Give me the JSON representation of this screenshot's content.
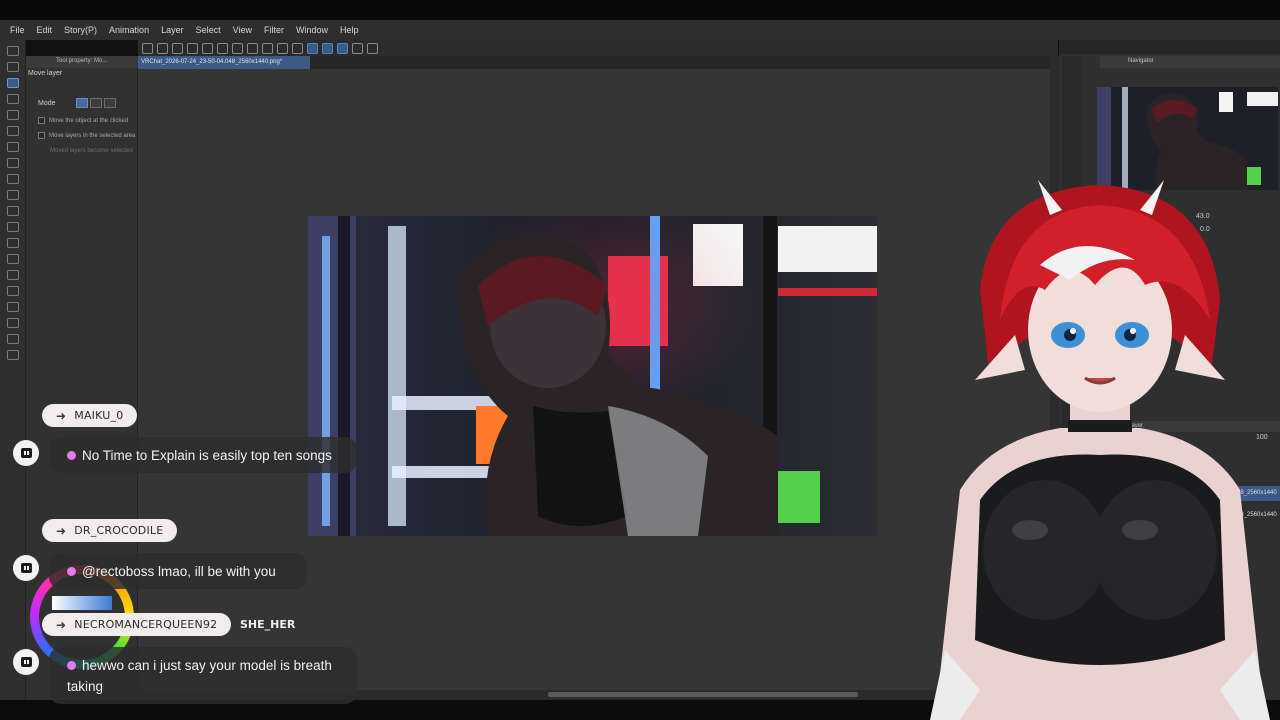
{
  "menu": {
    "items": [
      "File",
      "Edit",
      "Story(P)",
      "Animation",
      "Layer",
      "Select",
      "View",
      "Filter",
      "Window",
      "Help"
    ]
  },
  "tool_property": {
    "tab_label": "Tool property: Mo...",
    "title": "Move layer",
    "mode_label": "Mode",
    "options": [
      "Move the object at the clicked",
      "Move layers in the selected area",
      "Moved layers become selected"
    ]
  },
  "document": {
    "tab_label": "VRChat_2026-07-24_23-50-04.048_2560x1440.png*"
  },
  "navigator": {
    "title": "Navigator",
    "zoom": "43.0",
    "rotation": "0.0"
  },
  "layer_panel": {
    "title": "Layer",
    "opacity": "100",
    "layers": [
      "23-50-04.048_2560x1440",
      "23-50-04.048_2560x1440"
    ]
  },
  "chat": {
    "messages": [
      {
        "user": "MAIKU_0",
        "badge": "",
        "text": "No Time to Explain is easily top ten songs"
      },
      {
        "user": "DR_CROCODILE",
        "badge": "",
        "text": "@rectoboss lmao, ill be with you"
      },
      {
        "user": "NECROMANCERQUEEN92",
        "badge": "SHE_HER",
        "text": "hewwo can i just say your model is breath taking"
      }
    ]
  },
  "colors": {
    "accent_blue": "#3b5a85",
    "chat_name_bg": "#f3ecec",
    "chat_dot": "#e07de6",
    "avatar_hair": "#c8202a"
  },
  "icons": [
    "arrow-right-icon",
    "twitch-icon",
    "move-icon",
    "zoom-icon"
  ]
}
